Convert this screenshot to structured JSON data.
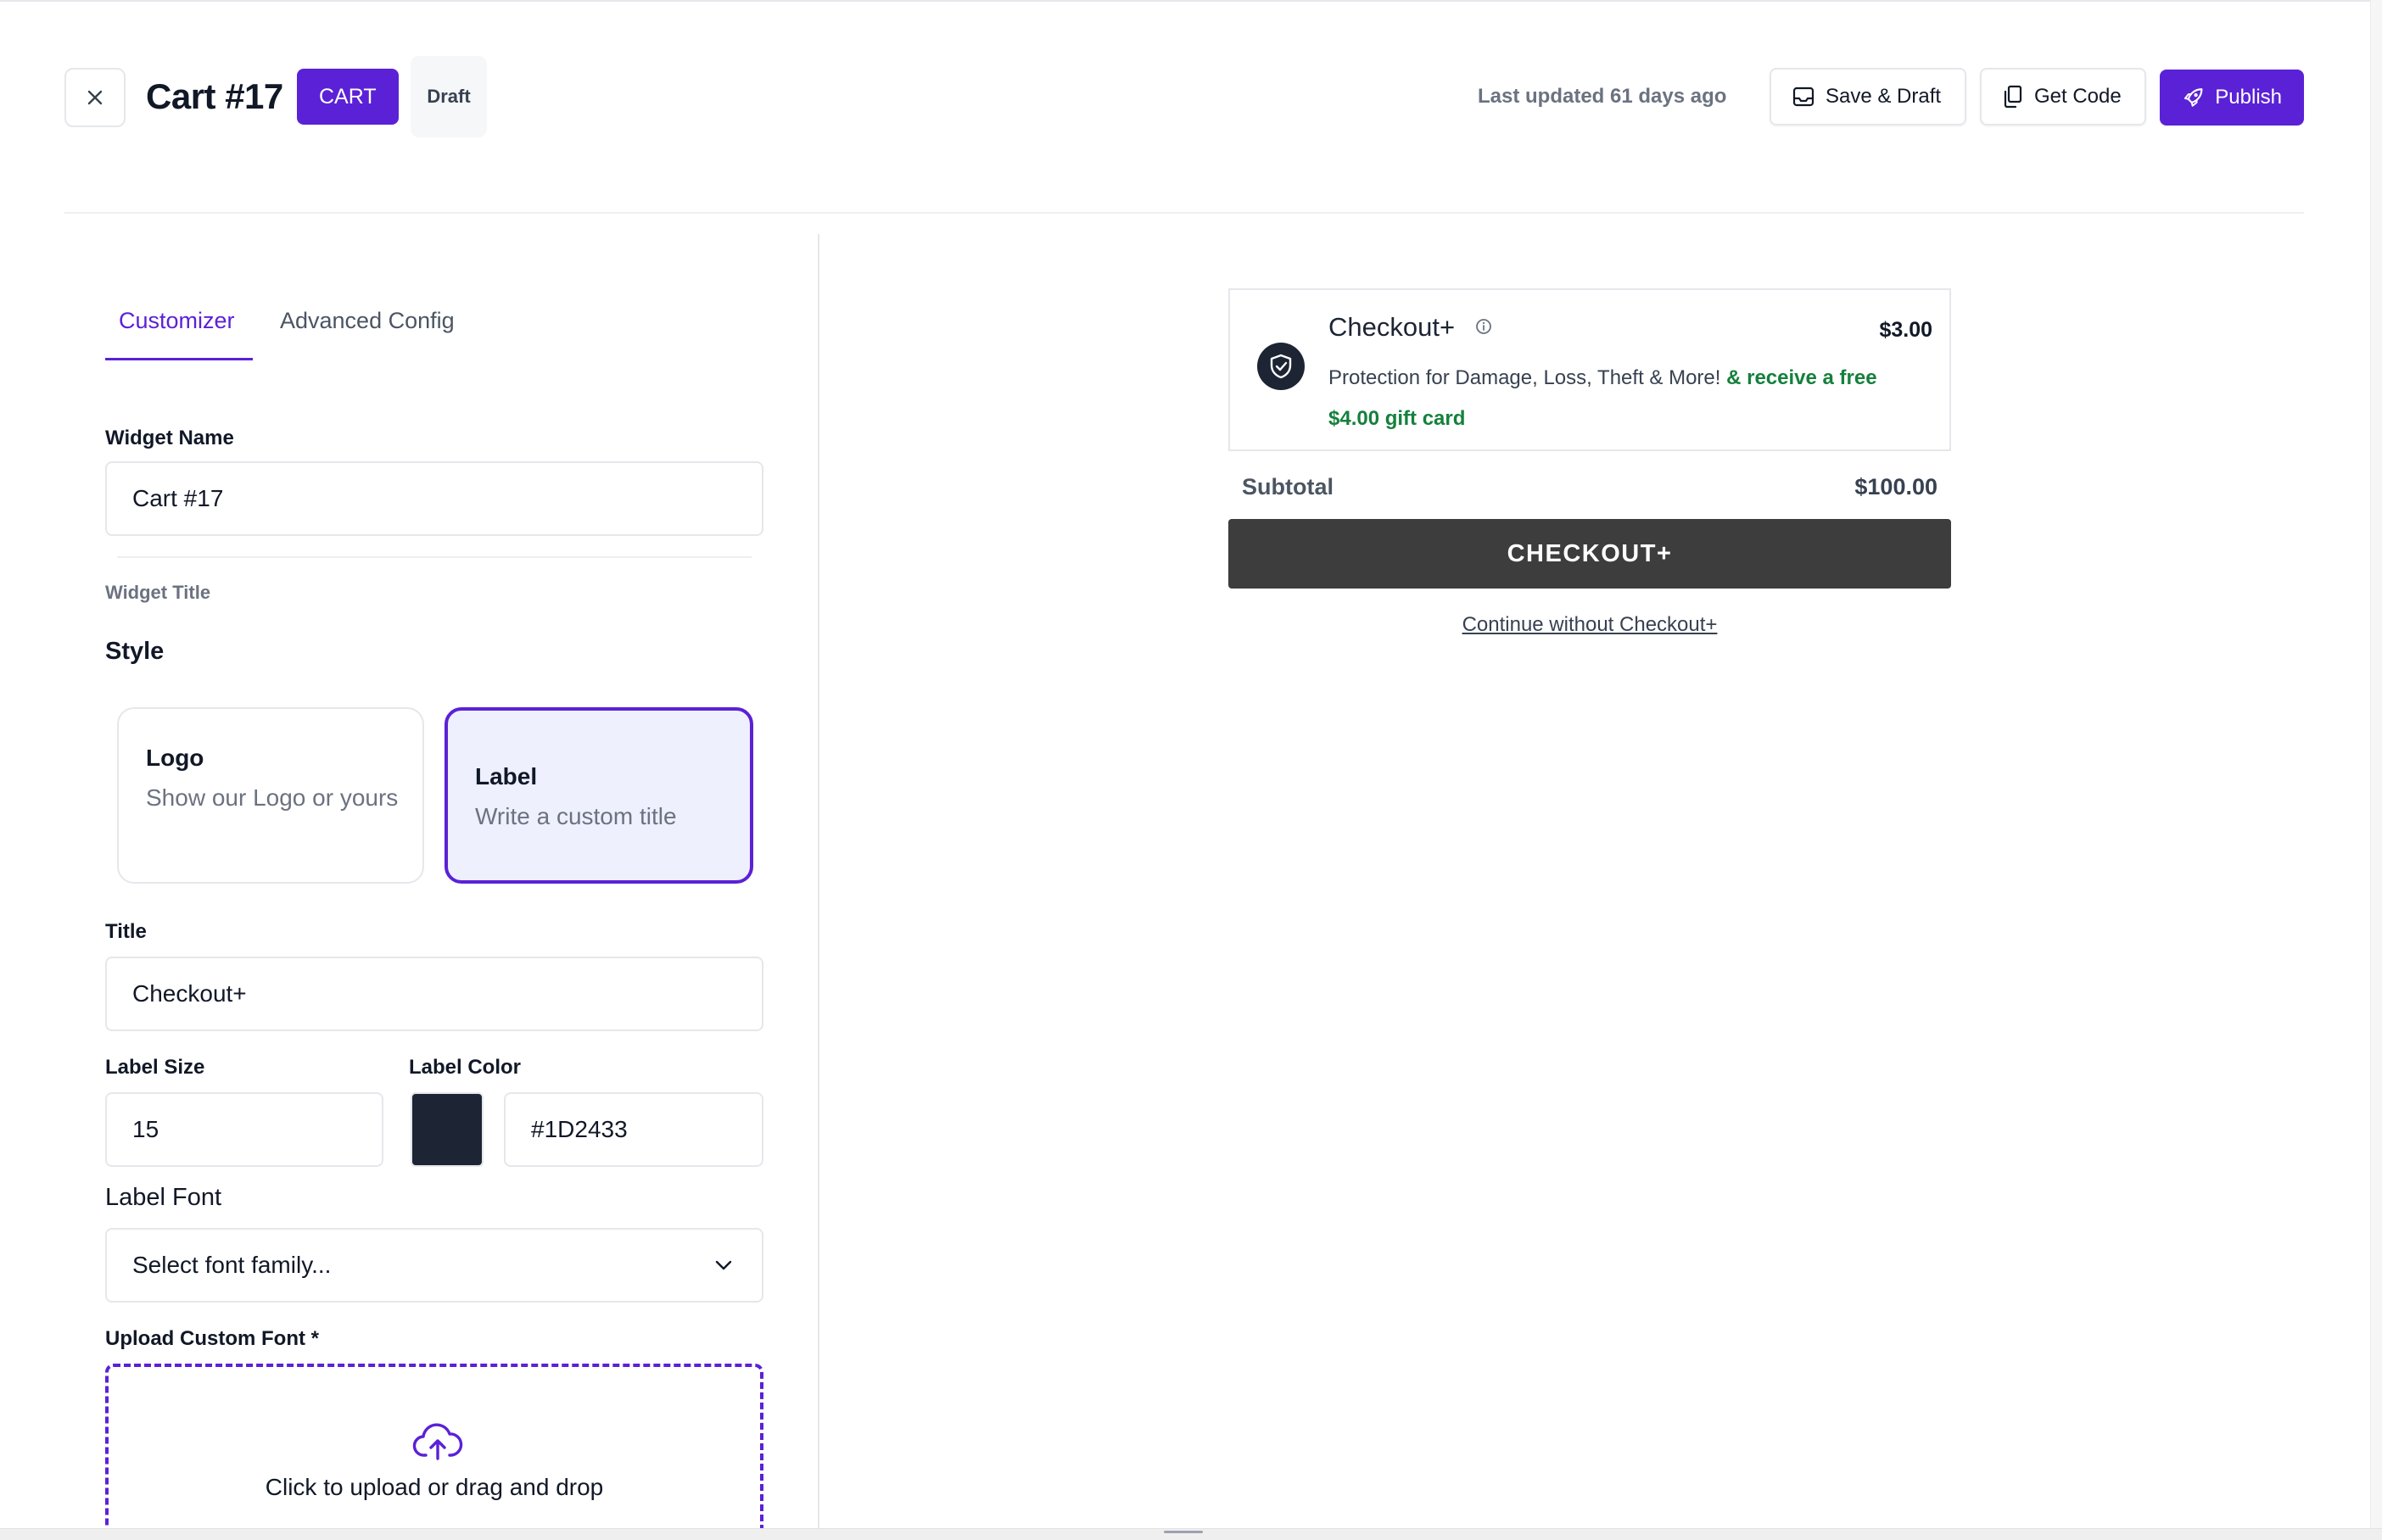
{
  "header": {
    "title": "Cart #17",
    "type_badge": "CART",
    "status_badge": "Draft",
    "last_updated": "Last updated 61 days ago",
    "save_label": "Save & Draft",
    "code_label": "Get Code",
    "publish_label": "Publish",
    "brand_color": "#5b21d6"
  },
  "tabs": [
    {
      "label": "Customizer",
      "active": true
    },
    {
      "label": "Advanced Config",
      "active": false
    }
  ],
  "form": {
    "widget_name_label": "Widget Name",
    "widget_name_value": "Cart #17",
    "widget_title_section": "Widget Title",
    "style_heading": "Style",
    "style_options": [
      {
        "title": "Logo",
        "desc": "Show our Logo or yours",
        "selected": false
      },
      {
        "title": "Label",
        "desc": "Write a custom title",
        "selected": true
      }
    ],
    "title_label": "Title",
    "title_value": "Checkout+",
    "label_size_label": "Label Size",
    "label_size_value": "15",
    "label_color_label": "Label Color",
    "label_color_value": "#1D2433",
    "label_font_label": "Label Font",
    "label_font_placeholder": "Select font family...",
    "upload_label": "Upload Custom Font *",
    "upload_text": "Click to upload or drag and drop"
  },
  "preview": {
    "title": "Checkout+",
    "price": "$3.00",
    "description": "Protection for Damage, Loss, Theft & More!",
    "gift_text": "& receive a free $4.00 gift card",
    "subtotal_label": "Subtotal",
    "subtotal_value": "$100.00",
    "checkout_button": "CHECKOUT+",
    "continue_link": "Continue without Checkout+",
    "gift_color": "#15803d",
    "button_color": "#3d3d3d"
  }
}
